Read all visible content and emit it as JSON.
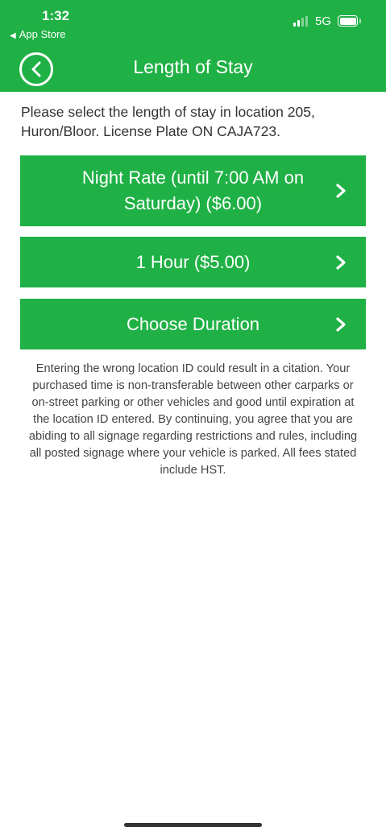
{
  "status_bar": {
    "time": "1:32",
    "back_app": "App Store",
    "network": "5G"
  },
  "nav": {
    "title": "Length of Stay",
    "back_icon": "circle-chevron-left-icon"
  },
  "intro_text": "Please select the length of stay in location 205, Huron/Bloor. License Plate ON CAJA723.",
  "options": [
    {
      "label": "Night Rate (until 7:00 AM on Saturday) ($6.00)",
      "icon": "chevron-right-icon"
    },
    {
      "label": "1 Hour ($5.00)",
      "icon": "chevron-right-icon"
    },
    {
      "label": "Choose Duration",
      "icon": "chevron-right-icon"
    }
  ],
  "disclaimer": "Entering the wrong location ID could result in a citation. Your purchased time is non-transferable between other carparks or on-street parking or other vehicles and good until expiration at the location ID entered. By continuing, you agree that you are abiding to all signage regarding restrictions and rules, including all posted signage where your vehicle is parked. All fees stated include HST.",
  "colors": {
    "brand_green": "#1fb145",
    "text": "#333333"
  }
}
